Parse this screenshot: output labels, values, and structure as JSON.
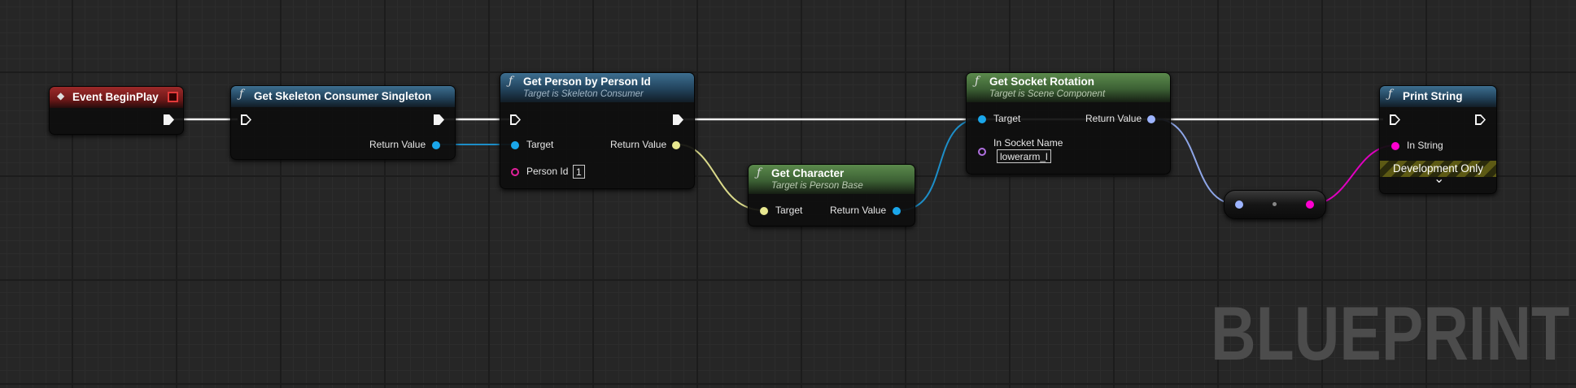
{
  "nodes": {
    "event_begin_play": {
      "title": "Event BeginPlay"
    },
    "get_skeleton_consumer_singleton": {
      "title": "Get Skeleton Consumer Singleton",
      "return_label": "Return Value"
    },
    "get_person_by_id": {
      "title": "Get Person by Person Id",
      "subtitle": "Target is Skeleton Consumer",
      "target_label": "Target",
      "return_label": "Return Value",
      "person_id_label": "Person Id",
      "person_id_value": "1"
    },
    "get_character": {
      "title": "Get Character",
      "subtitle": "Target is Person Base",
      "target_label": "Target",
      "return_label": "Return Value"
    },
    "get_socket_rotation": {
      "title": "Get Socket Rotation",
      "subtitle": "Target is Scene Component",
      "target_label": "Target",
      "return_label": "Return Value",
      "socket_name_label": "In Socket Name",
      "socket_name_value": "lowerarm_l"
    },
    "print_string": {
      "title": "Print String",
      "in_string_label": "In String",
      "dev_only_label": "Development Only",
      "expand_glyph": "⌄"
    }
  },
  "function_glyph": "ƒ",
  "event_glyph": "◆",
  "watermark": "BLUEPRINT",
  "colors": {
    "exec": "#f4f4f4",
    "object_pin": "#1aa6ea",
    "struct_pin": "#e8e890",
    "rotator_pin": "#9db4ff",
    "string_pin": "#ff00d0",
    "int_pin": "#1ee3b8"
  }
}
